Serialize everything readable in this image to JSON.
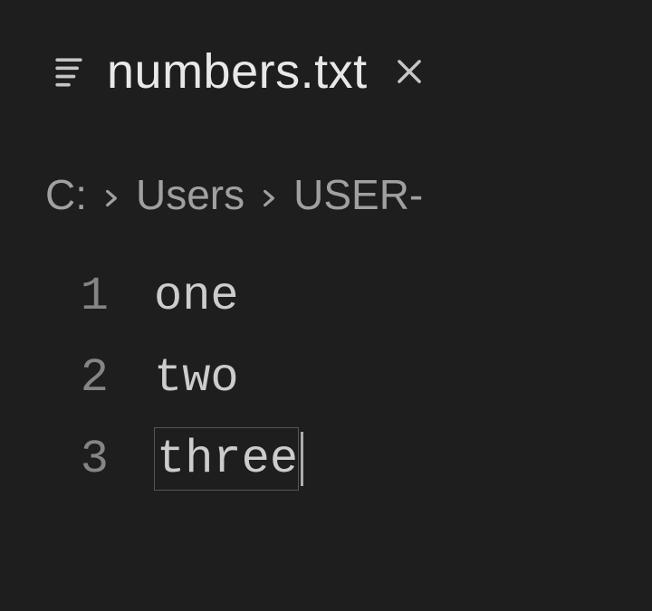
{
  "tab": {
    "label": "numbers.txt"
  },
  "breadcrumb": {
    "items": [
      "C:",
      "Users",
      "USER-"
    ]
  },
  "editor": {
    "lines": [
      {
        "num": "1",
        "text": "one"
      },
      {
        "num": "2",
        "text": "two"
      },
      {
        "num": "3",
        "text": "three"
      }
    ]
  }
}
